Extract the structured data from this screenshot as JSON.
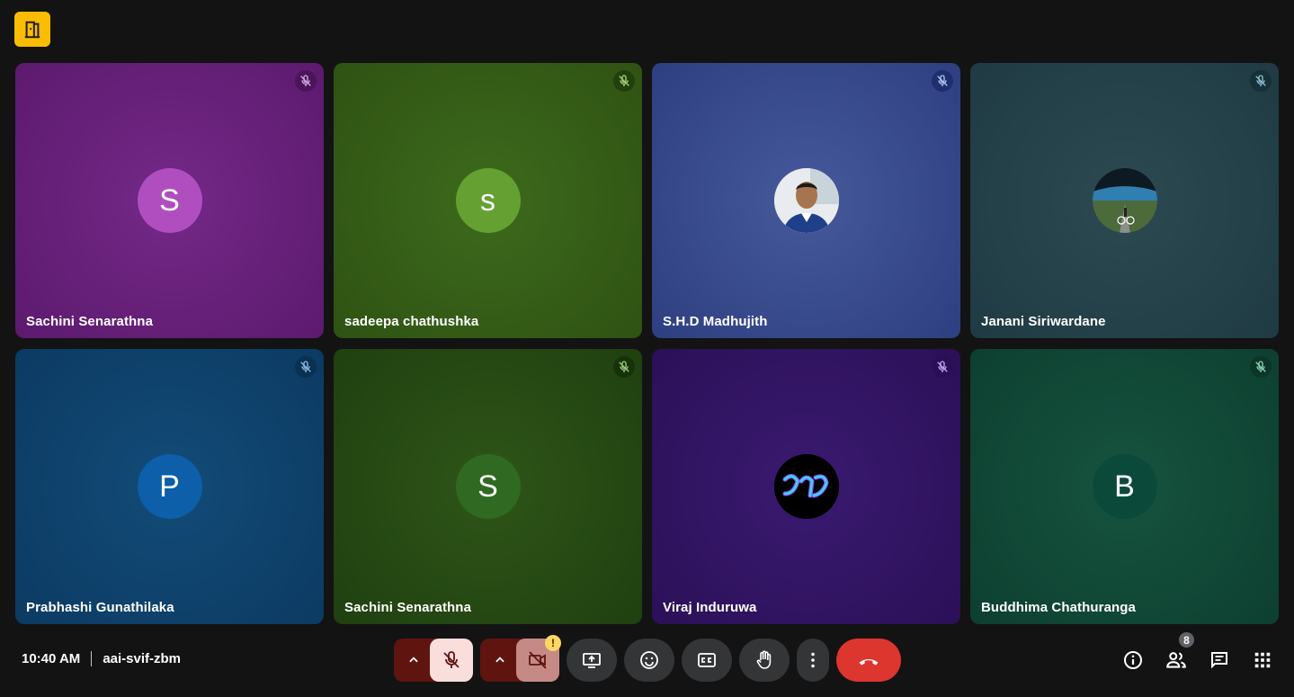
{
  "app": {
    "logo_icon": "door-exit-icon",
    "accent": "#fbbc04"
  },
  "participants": [
    {
      "name": "Sachini Senarathna",
      "initial": "S",
      "avatar_color": "#b04ec0",
      "bg": "radial-gradient(circle at 50% 50%, #742888 0%, #5c1a6e 100%)",
      "mic_bg": "#4a1658",
      "mic_color": "#d7a9e6",
      "photo": false
    },
    {
      "name": "sadeepa chathushka",
      "initial": "s",
      "avatar_color": "#65a033",
      "bg": "radial-gradient(circle at 50% 50%, #3d6a1c 0%, #2f5213 100%)",
      "mic_bg": "#23400c",
      "mic_color": "#a8d47f",
      "photo": false
    },
    {
      "name": "S.H.D Madhujith",
      "initial": "",
      "avatar_color": "#d9c8b5",
      "bg": "radial-gradient(circle at 50% 50%, #46599a 0%, #2d3f80 100%)",
      "mic_bg": "#1e2e6e",
      "mic_color": "#b8c6f0",
      "photo": "person"
    },
    {
      "name": "Janani Siriwardane",
      "initial": "",
      "avatar_color": "#3d5a60",
      "bg": "radial-gradient(circle at 50% 50%, #2c4a52 0%, #1f3a43 100%)",
      "mic_bg": "#163039",
      "mic_color": "#8fc0cc",
      "photo": "landscape"
    },
    {
      "name": "Prabhashi Gunathilaka",
      "initial": "P",
      "avatar_color": "#0c5fa8",
      "bg": "radial-gradient(circle at 50% 50%, #124c78 0%, #0c3a62 100%)",
      "mic_bg": "#0a3052",
      "mic_color": "#8fbce6",
      "photo": false
    },
    {
      "name": "Sachini Senarathna",
      "initial": "S",
      "avatar_color": "#306a22",
      "bg": "radial-gradient(circle at 50% 50%, #2f5518 0%, #1f4010 100%)",
      "mic_bg": "#183208",
      "mic_color": "#9ccc7e",
      "photo": false
    },
    {
      "name": "Viraj Induruwa",
      "initial": "",
      "avatar_color": "#000000",
      "bg": "radial-gradient(circle at 50% 50%, #3a1a70 0%, #2b1058 100%)",
      "mic_bg": "#2a0f56",
      "mic_color": "#c7a8f0",
      "photo": "logo"
    },
    {
      "name": "Buddhima Chathuranga",
      "initial": "B",
      "avatar_color": "#0b4a3a",
      "bg": "radial-gradient(circle at 50% 50%, #16543f 0%, #0d3f30 100%)",
      "mic_bg": "#0a3527",
      "mic_color": "#8fd4b6",
      "photo": false
    }
  ],
  "bottom": {
    "time": "10:40 AM",
    "meeting_code": "aai-svif-zbm",
    "participant_count": "8",
    "controls": {
      "audio_options": "chevron-up-icon",
      "mic": "mic-off-icon",
      "video_options": "chevron-up-icon",
      "camera": "camera-off-icon",
      "camera_warning": "!",
      "present": "present-screen-icon",
      "reactions": "emoji-icon",
      "captions": "captions-icon",
      "raise_hand": "hand-icon",
      "more": "more-vert-icon",
      "end_call": "call-end-icon"
    },
    "right": [
      "info-icon",
      "people-icon",
      "chat-icon",
      "activities-icon"
    ],
    "colors": {
      "danger_dark": "#601410",
      "mic_off_bg": "#f9dedc",
      "cam_off_bg": "#c58a85",
      "end_call": "#dc362e",
      "btn_bg": "#333537"
    }
  }
}
